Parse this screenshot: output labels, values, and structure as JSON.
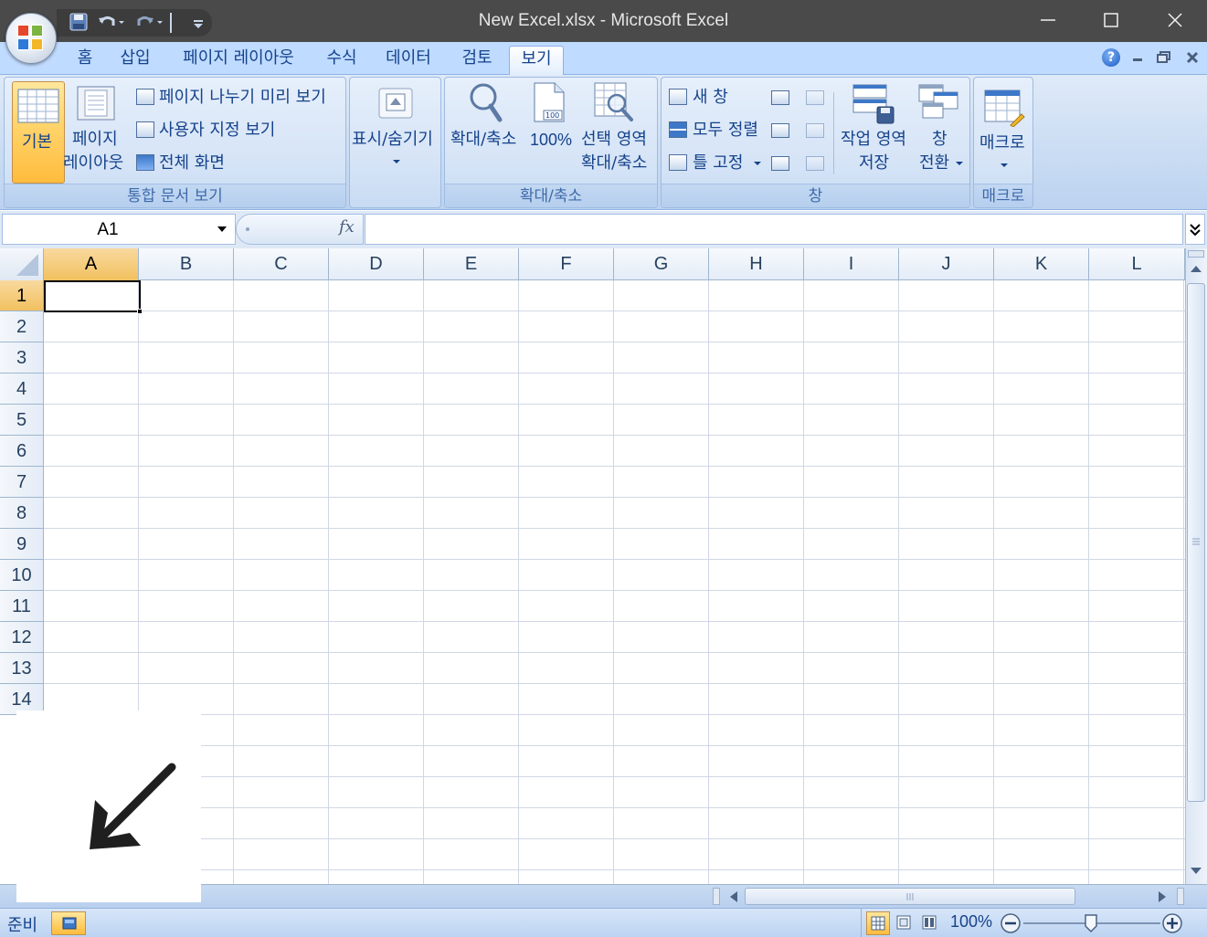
{
  "window": {
    "title": "New Excel.xlsx - Microsoft Excel",
    "minimize": "—",
    "maximize": "☐",
    "close": "✕"
  },
  "qat": {
    "save_icon": "save-icon",
    "undo_icon": "undo-icon",
    "redo_icon": "redo-icon",
    "customize_icon": "customize-qat-icon"
  },
  "tabs": [
    {
      "label": "홈"
    },
    {
      "label": "삽입"
    },
    {
      "label": "페이지 레이아웃"
    },
    {
      "label": "수식"
    },
    {
      "label": "데이터"
    },
    {
      "label": "검토"
    },
    {
      "label": "보기",
      "active": true
    }
  ],
  "ribbon": {
    "workbook_views": {
      "label": "통합 문서 보기",
      "normal": "기본",
      "page_layout_1": "페이지",
      "page_layout_2": "레이아웃",
      "page_break_preview": "페이지 나누기 미리 보기",
      "custom_views": "사용자 지정 보기",
      "full_screen": "전체 화면"
    },
    "show_hide": {
      "label": "표시/숨기기"
    },
    "zoom": {
      "label": "확대/축소",
      "zoom": "확대/축소",
      "hundred": "100%",
      "zoom_sel_1": "선택 영역",
      "zoom_sel_2": "확대/축소"
    },
    "window": {
      "label": "창",
      "new_window": "새 창",
      "arrange_all": "모두 정렬",
      "freeze_panes": "틀 고정",
      "save_workspace_1": "작업 영역",
      "save_workspace_2": "저장",
      "switch_windows_1": "창",
      "switch_windows_2": "전환"
    },
    "macros": {
      "label": "매크로",
      "macros": "매크로"
    }
  },
  "formula_bar": {
    "name_box": "A1",
    "fx": "fx",
    "value": ""
  },
  "grid": {
    "columns": [
      "A",
      "B",
      "C",
      "D",
      "E",
      "F",
      "G",
      "H",
      "I",
      "J",
      "K",
      "L"
    ],
    "rows": [
      "1",
      "2",
      "3",
      "4",
      "5",
      "6",
      "7",
      "8",
      "9",
      "10",
      "11",
      "12",
      "13",
      "14"
    ],
    "active_cell": "A1"
  },
  "status": {
    "ready": "준비",
    "zoom": "100%"
  },
  "colors": {
    "ribbon_text": "#15428b",
    "selected_header": "#f1c15f",
    "gridline": "#d0d7e5"
  }
}
